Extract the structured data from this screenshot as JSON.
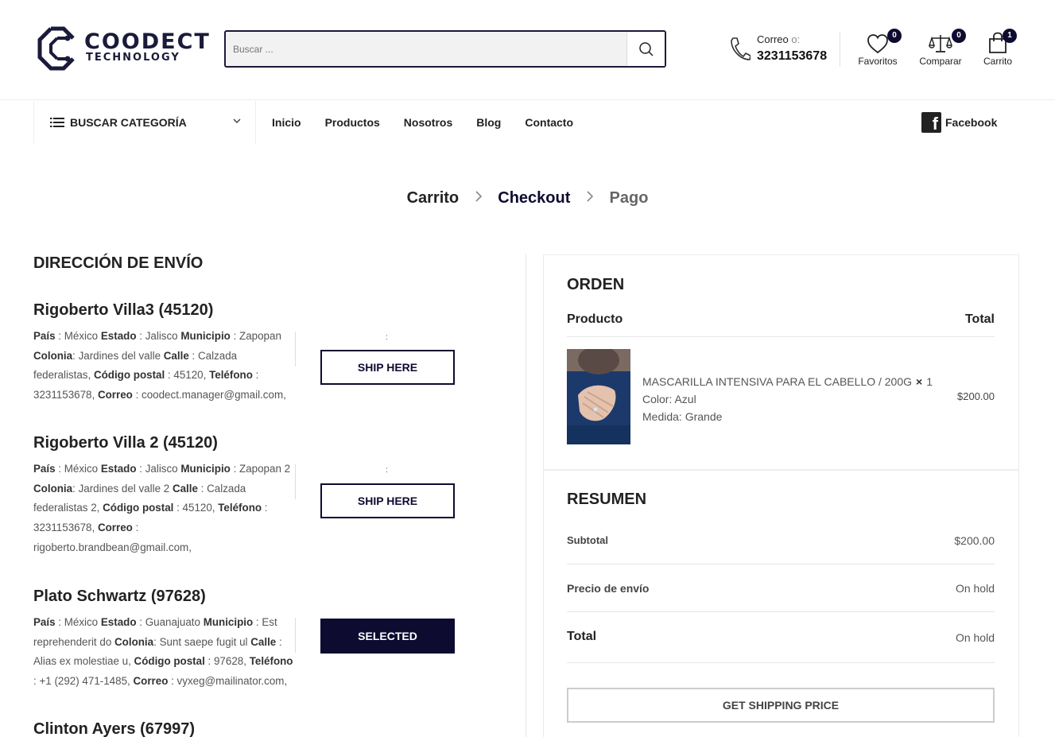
{
  "header": {
    "brand_top": "COODECT",
    "brand_bottom": "TECHNOLOGY",
    "search_placeholder": "Buscar ...",
    "contact_label": "Correo",
    "contact_label_o": "o:",
    "contact_phone": "3231153678",
    "favorites": {
      "label": "Favoritos",
      "count": "0"
    },
    "compare": {
      "label": "Comparar",
      "count": "0"
    },
    "cart": {
      "label": "Carrito",
      "count": "1"
    }
  },
  "nav": {
    "category_label": "BUSCAR CATEGORÍA",
    "links": [
      "Inicio",
      "Productos",
      "Nosotros",
      "Blog",
      "Contacto"
    ],
    "facebook": "Facebook"
  },
  "steps": [
    "Carrito",
    "Checkout",
    "Pago"
  ],
  "shipping": {
    "title": "DIRECCIÓN DE ENVÍO",
    "labels": {
      "pais": "País",
      "estado": "Estado",
      "municipio": "Municipio",
      "colonia": "Colonia",
      "calle": "Calle",
      "cp": "Código postal",
      "telefono": "Teléfono",
      "correo": "Correo"
    },
    "addresses": [
      {
        "name": "Rigoberto Villa3 (45120)",
        "pais": "México",
        "estado": "Jalisco",
        "municipio": "Zapopan",
        "colonia": "Jardines del valle",
        "calle": "Calzada federalistas",
        "cp": "45120",
        "telefono": "3231153678",
        "correo": "coodect.manager@gmail.com,",
        "button": "SHIP HERE"
      },
      {
        "name": "Rigoberto Villa 2 (45120)",
        "pais": "México",
        "estado": "Jalisco",
        "municipio": "Zapopan 2",
        "colonia": "Jardines del valle 2",
        "calle": "Calzada federalistas 2",
        "cp": "45120",
        "telefono": "3231153678",
        "correo": "rigoberto.brandbean@gmail.com,",
        "button": "SHIP HERE"
      },
      {
        "name": "Plato Schwartz (97628)",
        "pais": "México",
        "estado": "Guanajuato",
        "municipio": "Est reprehenderit do",
        "colonia": "Sunt saepe fugit ul",
        "calle": "Alias ex molestiae u",
        "cp": "97628",
        "telefono": "+1 (292) 471-1485",
        "correo": "vyxeg@mailinator.com,",
        "button": "SELECTED"
      },
      {
        "name": "Clinton Ayers (67997)"
      }
    ]
  },
  "order": {
    "title": "ORDEN",
    "col_product": "Producto",
    "col_total": "Total",
    "item": {
      "name": "MASCARILLA INTENSIVA PARA EL CABELLO / 200G",
      "qty_symbol": "×",
      "qty": "1",
      "color": "Color: Azul",
      "size": "Medida: Grande",
      "price": "$200.00"
    }
  },
  "summary": {
    "title": "RESUMEN",
    "subtotal_label": "Subtotal",
    "subtotal_value": "$200.00",
    "shipping_label": "Precio de envío",
    "shipping_value": "On hold",
    "total_label": "Total",
    "total_value": "On hold",
    "button": "GET SHIPPING PRICE"
  },
  "colors": {
    "primary": "#0e0b30"
  }
}
